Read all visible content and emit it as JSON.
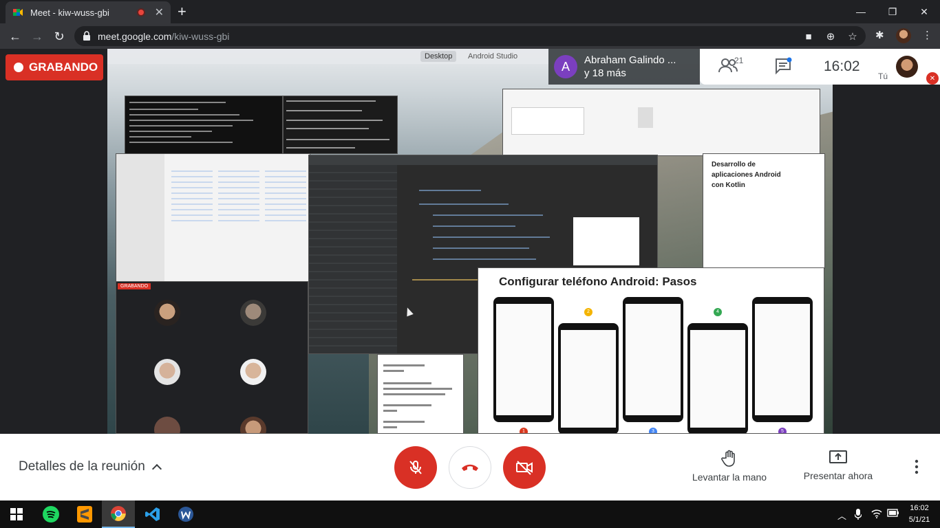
{
  "browser": {
    "tab_title": "Meet - kiw-wuss-gbi",
    "url_host": "meet.google.com",
    "url_path": "/kiw-wuss-gbi"
  },
  "meet": {
    "recording_label": "GRABANDO",
    "presenter_name": "Abraham Galindo ...",
    "presenter_more": "y 18 más",
    "presenter_initial": "A",
    "participant_count": "21",
    "time": "16:02",
    "self_label": "Tú"
  },
  "shared_screen": {
    "tabs": [
      "Desktop",
      "Android Studio"
    ],
    "doc_title": "Desarrollo de aplicaciones Android con Kotlin",
    "slide_title": "Configurar teléfono Android: Pasos",
    "grid_badge": "GRABANDO",
    "step_numbers": [
      "1",
      "2",
      "3",
      "4",
      "5"
    ]
  },
  "bottom_bar": {
    "details_label": "Detalles de la reunión",
    "raise_hand_label": "Levantar la mano",
    "present_label": "Presentar ahora"
  },
  "taskbar": {
    "time": "16:02",
    "date": "5/1/21"
  },
  "colors": {
    "recording_red": "#d93025",
    "presenter_avatar": "#7b3fbf",
    "chrome_dark": "#202124"
  }
}
